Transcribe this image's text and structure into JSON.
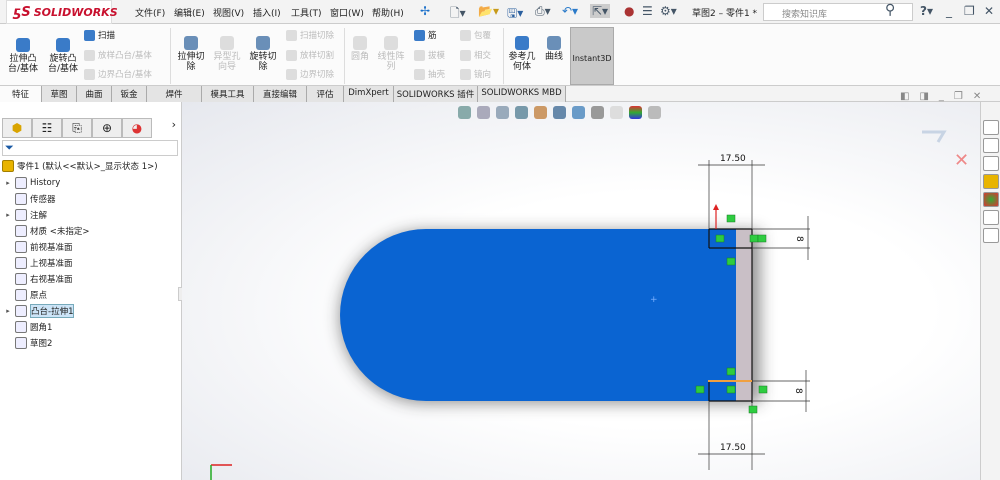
{
  "app": {
    "brand": "SOLIDWORKS",
    "document_title": "草图2 – 零件1 *",
    "search_placeholder": "搜索知识库"
  },
  "menu": [
    "文件(F)",
    "编辑(E)",
    "视图(V)",
    "插入(I)",
    "工具(T)",
    "窗口(W)",
    "帮助(H)"
  ],
  "ribbon": {
    "extrude_boss": "拉伸凸台/基体",
    "revolve_boss": "旋转凸台/基体",
    "sweep": "扫描",
    "loft_boss": "放样凸台/基体",
    "boundary_boss": "边界凸台/基体",
    "extrude_cut": "拉伸切除",
    "hole_wizard": "异型孔向导",
    "revolve_cut": "旋转切除",
    "swept_cut": "扫描切除",
    "lofted_cut": "放样切割",
    "boundary_cut": "边界切除",
    "fillet": "圆角",
    "linear_pattern": "线性阵列",
    "rib": "筋",
    "draft": "拔模",
    "shell": "抽壳",
    "wrap": "包覆",
    "intersect": "相交",
    "mirror": "镜向",
    "ref_geometry": "参考几何体",
    "curves": "曲线",
    "instant3d": "Instant3D"
  },
  "tabs": [
    "特征",
    "草图",
    "曲面",
    "钣金",
    "焊件",
    "模具工具",
    "直接编辑",
    "评估",
    "DimXpert",
    "SOLIDWORKS 插件",
    "SOLIDWORKS MBD"
  ],
  "tree": {
    "root": "零件1  (默认<<默认>_显示状态 1>)",
    "items": [
      {
        "label": "History",
        "expandable": true
      },
      {
        "label": "传感器",
        "expandable": false
      },
      {
        "label": "注解",
        "expandable": true
      },
      {
        "label": "材质 <未指定>",
        "expandable": false
      },
      {
        "label": "前视基准面",
        "expandable": false
      },
      {
        "label": "上视基准面",
        "expandable": false
      },
      {
        "label": "右视基准面",
        "expandable": false
      },
      {
        "label": "原点",
        "expandable": false
      },
      {
        "label": "凸台-拉伸1",
        "expandable": true,
        "selected": true
      },
      {
        "label": "圆角1",
        "expandable": false
      },
      {
        "label": "草图2",
        "expandable": false
      }
    ]
  },
  "sketch": {
    "dim_top": "17.50",
    "dim_bottom": "17.50",
    "dim_right_top": "8",
    "dim_right_bottom": "8"
  },
  "colors": {
    "part_blue": "#0a64d2",
    "relation_green": "#2ecc40",
    "accent_red": "#c8102e"
  }
}
